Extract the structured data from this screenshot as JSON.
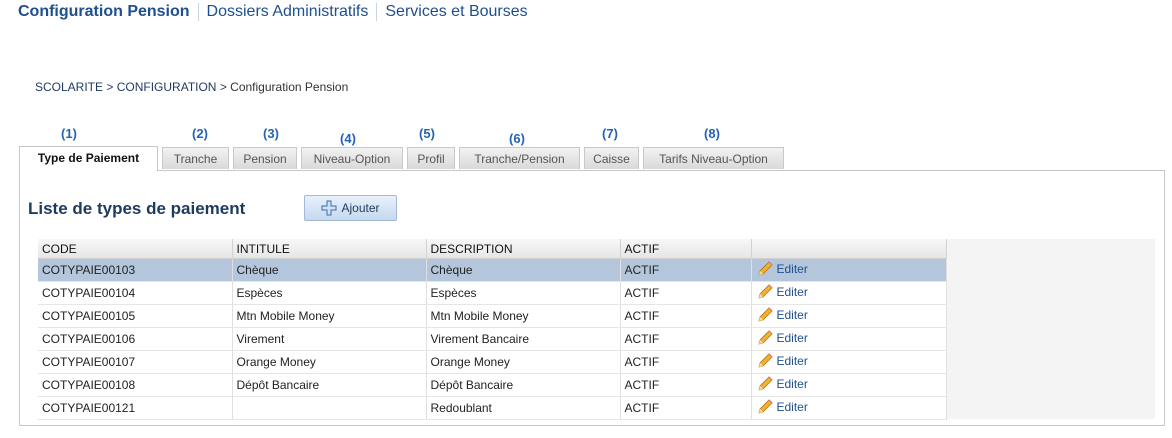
{
  "topnav": [
    "Configuration Pension",
    "Dossiers Administratifs",
    "Services et Bourses"
  ],
  "breadcrumb": {
    "p1": "SCOLARITE",
    "sep": " > ",
    "p2": "CONFIGURATION",
    "p3": "Configuration Pension"
  },
  "tab_numbers": [
    "(1)",
    "(2)",
    "(3)",
    "(4)",
    "(5)",
    "(6)",
    "(7)",
    "(8)"
  ],
  "tabs": [
    "Type de Paiement",
    "Tranche",
    "Pension",
    "Niveau-Option",
    "Profil",
    "Tranche/Pension",
    "Caisse",
    "Tarifs Niveau-Option"
  ],
  "active_tab": 0,
  "panel": {
    "title": "Liste de types de paiement",
    "add_label": "Ajouter"
  },
  "table": {
    "headers": [
      "CODE",
      "INTITULE",
      "DESCRIPTION",
      "ACTIF",
      ""
    ],
    "edit_label": "Editer",
    "selected_row": 0,
    "rows": [
      {
        "code": "COTYPAIE00103",
        "intitule": "Chèque",
        "description": "Chèque",
        "actif": "ACTIF"
      },
      {
        "code": "COTYPAIE00104",
        "intitule": "Espèces",
        "description": "Espèces",
        "actif": "ACTIF"
      },
      {
        "code": "COTYPAIE00105",
        "intitule": "Mtn Mobile Money",
        "description": "Mtn Mobile Money",
        "actif": "ACTIF"
      },
      {
        "code": "COTYPAIE00106",
        "intitule": "Virement",
        "description": "Virement Bancaire",
        "actif": "ACTIF"
      },
      {
        "code": "COTYPAIE00107",
        "intitule": "Orange Money",
        "description": "Orange Money",
        "actif": "ACTIF"
      },
      {
        "code": "COTYPAIE00108",
        "intitule": "Dépôt Bancaire",
        "description": "Dépôt Bancaire",
        "actif": "ACTIF"
      },
      {
        "code": "COTYPAIE00121",
        "intitule": "",
        "description": "Redoublant",
        "actif": "ACTIF"
      }
    ]
  },
  "colors": {
    "accent": "#1e4f8e",
    "selected_row": "#b4c6dc",
    "tab_number": "#2563b5"
  },
  "icons": {
    "add": "plus-icon",
    "edit": "pencil-icon"
  }
}
